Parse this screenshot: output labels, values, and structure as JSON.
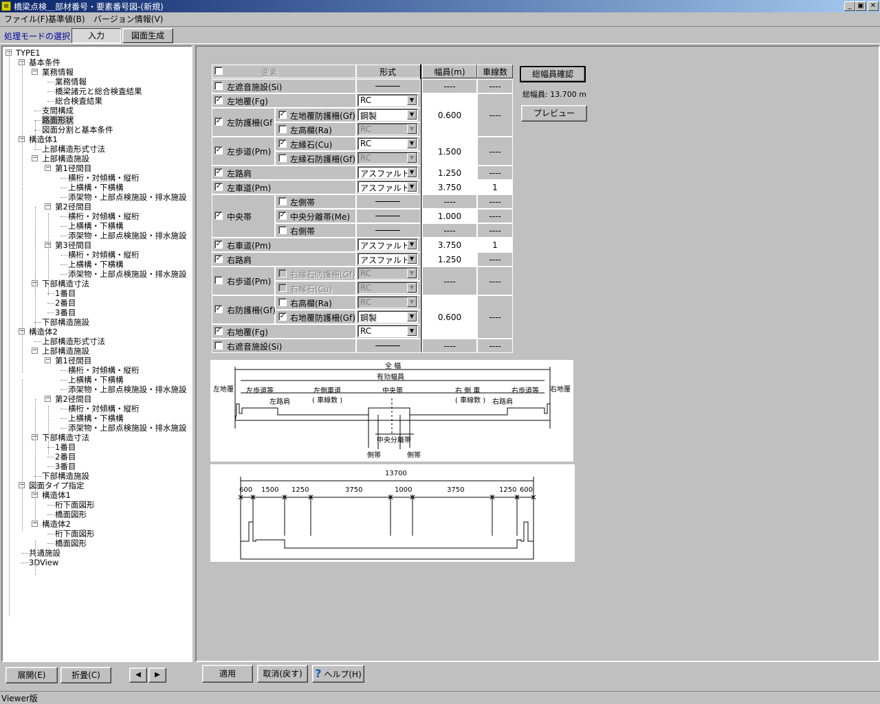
{
  "window": {
    "title": "橋梁点検＿部材番号・要素番号図-(新規)",
    "icon": "app-icon",
    "min": "_",
    "max": "▣",
    "close": "✕"
  },
  "menu": {
    "file": "ファイル(F)",
    "base": "基準値(B)",
    "version": "バージョン情報(V)"
  },
  "mode": {
    "label": "処理モードの選択",
    "input": "入力",
    "generate": "図面生成"
  },
  "tree": {
    "expander_minus": "−",
    "items": [
      "TYPE1",
      "基本条件",
      "業務情報",
      "業務情報",
      "橋梁諸元と総合検査結果",
      "総合検査結果",
      "支間構成",
      "路面形状",
      "図面分割と基本条件",
      "構造体1",
      "上部構造形式寸法",
      "上部構造施設",
      "第1径間目",
      "横桁・対傾構・縦桁",
      "上横構・下横構",
      "添架物・上部点検施設・排水施設",
      "第2径間目",
      "横桁・対傾構・縦桁",
      "上横構・下横構",
      "添架物・上部点検施設・排水施設",
      "第3径間目",
      "横桁・対傾構・縦桁",
      "上横構・下横構",
      "添架物・上部点検施設・排水施設",
      "下部構造寸法",
      "1番目",
      "2番目",
      "3番目",
      "下部構造施設",
      "構造体2",
      "上部構造形式寸法",
      "上部構造施設",
      "第1径間目",
      "横桁・対傾構・縦桁",
      "上横構・下横構",
      "添架物・上部点検施設・排水施設",
      "第2径間目",
      "横桁・対傾構・縦桁",
      "上横構・下横構",
      "添架物・上部点検施設・排水施設",
      "下部構造寸法",
      "1番目",
      "2番目",
      "3番目",
      "下部構造施設",
      "図面タイプ指定",
      "構造体1",
      "桁下面図形",
      "橋面図形",
      "構造体2",
      "桁下面図形",
      "橋面図形",
      "共通施設",
      "3DView"
    ]
  },
  "tree_buttons": {
    "expand": "展開(E)",
    "collapse": "折畳(C)",
    "prev": "◀",
    "next": "▶"
  },
  "grid": {
    "headers": {
      "element": "要素",
      "type": "形式",
      "width": "幅員(m)",
      "lanes": "車線数"
    },
    "check": "✓",
    "dropdown_arrow": "▼",
    "rows": {
      "r1": "左遮音施設(Si)",
      "r2": "左地覆(Fg)",
      "r3": "左防護柵(Gf",
      "r3a": "左地覆防護柵(Gf)",
      "r3b": "左高欄(Ra)",
      "r4": "左歩道(Pm)",
      "r4a": "左縁石(Cu)",
      "r4b": "左縁石防護柵(Gf)",
      "r5": "左路肩",
      "r6": "左車道(Pm)",
      "r7": "中央帯",
      "r7a": "左側帯",
      "r7b": "中央分離帯(Me)",
      "r7c": "右側帯",
      "r8": "右車道(Pm)",
      "r9": "右路肩",
      "r10": "右歩道(Pm)",
      "r10a": "右縁石防護柵(Gf)",
      "r10b": "右縁石(Cu)",
      "r11": "右防護柵(Gf)",
      "r11a": "右高欄(Ra)",
      "r11b": "右地覆防護柵(Gf)",
      "r12": "右地覆(Fg)",
      "r13": "右遮音施設(Si)"
    },
    "types": {
      "rc": "RC",
      "steel": "鋼製",
      "asphalt": "アスファルト"
    },
    "values": {
      "dash": "----",
      "w1": "0.600",
      "w2": "1.500",
      "w3": "1.250",
      "w4": "3.750",
      "w5": "1.000",
      "l1": "1"
    }
  },
  "side": {
    "confirm": "総幅員確認",
    "total": "総幅員: 13.700 m",
    "preview": "プレビュー"
  },
  "diagram1": {
    "full": "全  幅",
    "effective": "有効幅員",
    "left_fg": "左地覆",
    "right_fg": "右地覆",
    "left_walk": "左歩道等",
    "right_walk": "右歩道等",
    "left_lane": "左側車道",
    "right_lane": "右 側 車",
    "lanes_l": "( 車線数 )",
    "lanes_r": "( 車線数 )",
    "center": "中央帯",
    "left_shoulder": "左路肩",
    "right_shoulder": "右路肩",
    "median": "中央分離帯",
    "side_l": "側帯",
    "side_r": "側帯"
  },
  "diagram2": {
    "total": "13700",
    "dims": [
      "600",
      "1500",
      "1250",
      "3750",
      "1000",
      "3750",
      "1250",
      "600"
    ]
  },
  "buttons": {
    "apply": "適用",
    "cancel": "取消(戻す)",
    "help": "ヘルプ(H)",
    "help_icon": "?"
  },
  "status": "Viewer版"
}
